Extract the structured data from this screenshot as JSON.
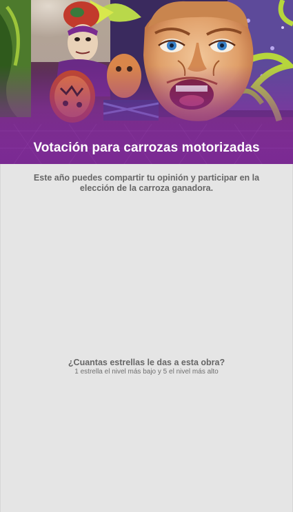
{
  "header": {
    "title": "Votación para carrozas motorizadas",
    "image_icon": "carnival-float-masks-photo"
  },
  "intro": {
    "text": "Este año puedes compartir tu opinión y participar en la elección de la carroza ganadora."
  },
  "rating": {
    "question": "¿Cuantas estrellas le das a esta obra?",
    "hint": "1 estrella el nivel más bajo y 5 el nivel más alto"
  },
  "colors": {
    "background": "#e5e5e5",
    "accent_purple": "#7c2a8c",
    "text_gray": "#666666",
    "title_white": "#ffffff"
  }
}
